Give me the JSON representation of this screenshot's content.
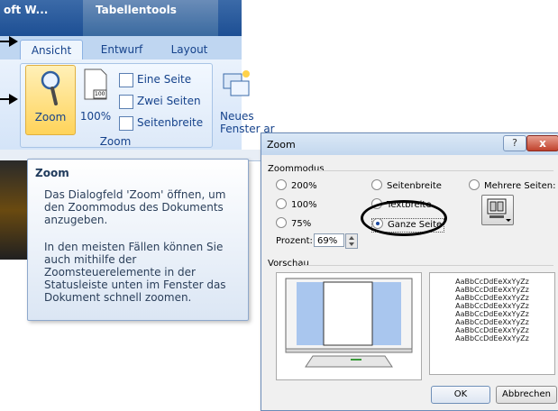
{
  "ribbon": {
    "window_title": "oft W...",
    "context_tab": "Tabellentools",
    "tabs": [
      {
        "label": "Ansicht",
        "active": true
      },
      {
        "label": "Entwurf",
        "active": false
      },
      {
        "label": "Layout",
        "active": false
      }
    ],
    "zoom_label": "Zoom",
    "btn100_label": "100%",
    "btn100_icon_text": "100",
    "small_buttons": [
      {
        "label": "Eine Seite",
        "icon": "one-page-icon"
      },
      {
        "label": "Zwei Seiten",
        "icon": "two-pages-icon"
      },
      {
        "label": "Seitenbreite",
        "icon": "page-width-icon"
      }
    ],
    "group_label": "Zoom",
    "neues_label_1": "Neues",
    "neues_label_2": "Fenster ar"
  },
  "tooltip": {
    "title": "Zoom",
    "p1": "Das Dialogfeld 'Zoom' öffnen, um den Zoommodus des Dokuments anzugeben.",
    "p2": "In den meisten Fällen können Sie auch mithilfe der Zoomsteuerelemente in der Statusleiste unten im Fenster das Dokument schnell zoomen."
  },
  "dialog": {
    "title": "Zoom",
    "help_glyph": "?",
    "close_glyph": "x",
    "zoommodus_label": "Zoommodus",
    "radios": [
      {
        "label": "200%",
        "selected": false
      },
      {
        "label": "100%",
        "selected": false
      },
      {
        "label": "75%",
        "selected": false
      },
      {
        "label": "Seitenbreite",
        "selected": false
      },
      {
        "label": "Textbreite",
        "selected": false
      },
      {
        "label": "Ganze Seite",
        "selected": true
      },
      {
        "label": "Mehrere Seiten:",
        "selected": false
      }
    ],
    "prozent_label": "Prozent:",
    "prozent_value": "69%",
    "vorschau_label": "Vorschau",
    "sample_text": "AaBbCcDdEeXxYyZz",
    "ok_label": "OK",
    "cancel_label": "Abbrechen"
  },
  "colors": {
    "ribbon_blue": "#15428b",
    "selected_radio": "#1c4aa0",
    "preview_blue": "#a9c6ee"
  }
}
